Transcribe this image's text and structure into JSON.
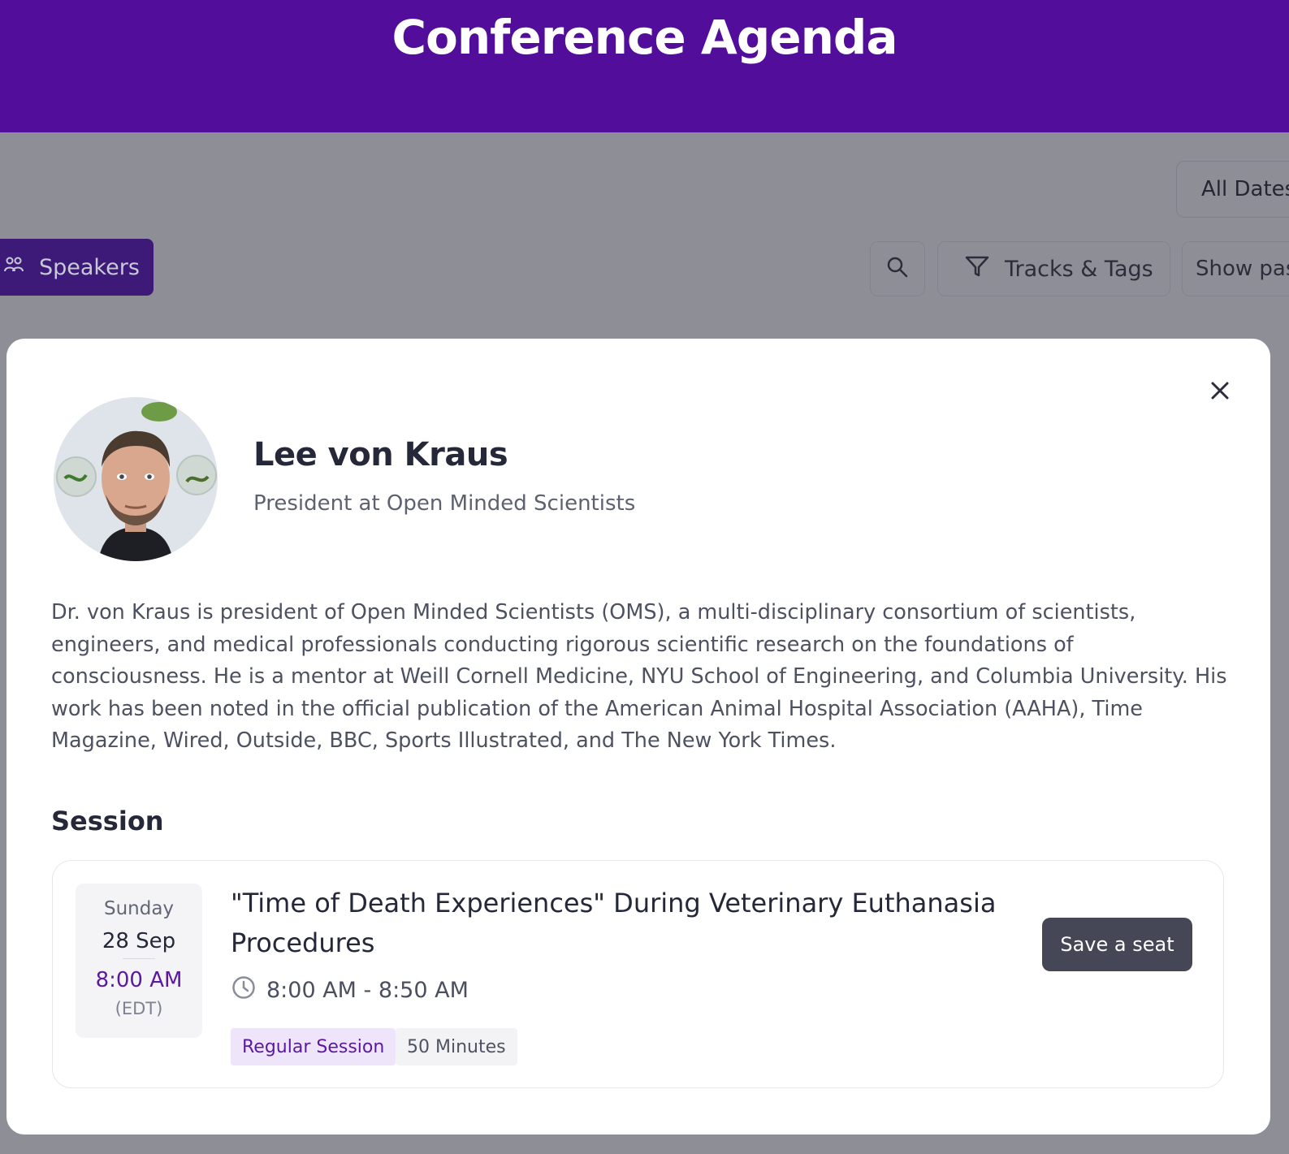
{
  "header": {
    "title": "Conference Agenda"
  },
  "toolbar": {
    "speakers_label": "Speakers",
    "all_dates_label": "All Dates",
    "tracks_label": "Tracks & Tags",
    "show_label": "Show past"
  },
  "modal": {
    "speaker": {
      "name": "Lee von Kraus",
      "role": "President at Open Minded Scientists",
      "bio": "Dr. von Kraus is president of Open Minded Scientists (OMS), a multi-disciplinary consortium of scientists, engineers, and medical professionals conducting rigorous scientific research on the foundations of consciousness. He is a mentor at Weill Cornell Medicine, NYU School of Engineering, and Columbia University. His work has been noted in the official publication of the American Animal Hospital Association (AAHA), Time Magazine, Wired, Outside, BBC, Sports Illustrated, and The New York Times."
    },
    "session_heading": "Session",
    "session": {
      "day": "Sunday",
      "date": "28 Sep",
      "start_time": "8:00 AM",
      "timezone": "(EDT)",
      "title": "\"Time of Death Experiences\" During Veterinary Euthanasia Procedures",
      "time_range": "8:00 AM - 8:50 AM",
      "tags": [
        "Regular Session",
        "50 Minutes"
      ],
      "save_label": "Save a seat"
    }
  },
  "colors": {
    "brand": "#520d9a",
    "accent_text": "#5a1aa0",
    "button_dark": "#454756"
  },
  "icons": {
    "speakers": "people-icon",
    "search": "search-icon",
    "filter": "filter-icon",
    "close": "close-icon",
    "clock": "clock-icon"
  }
}
